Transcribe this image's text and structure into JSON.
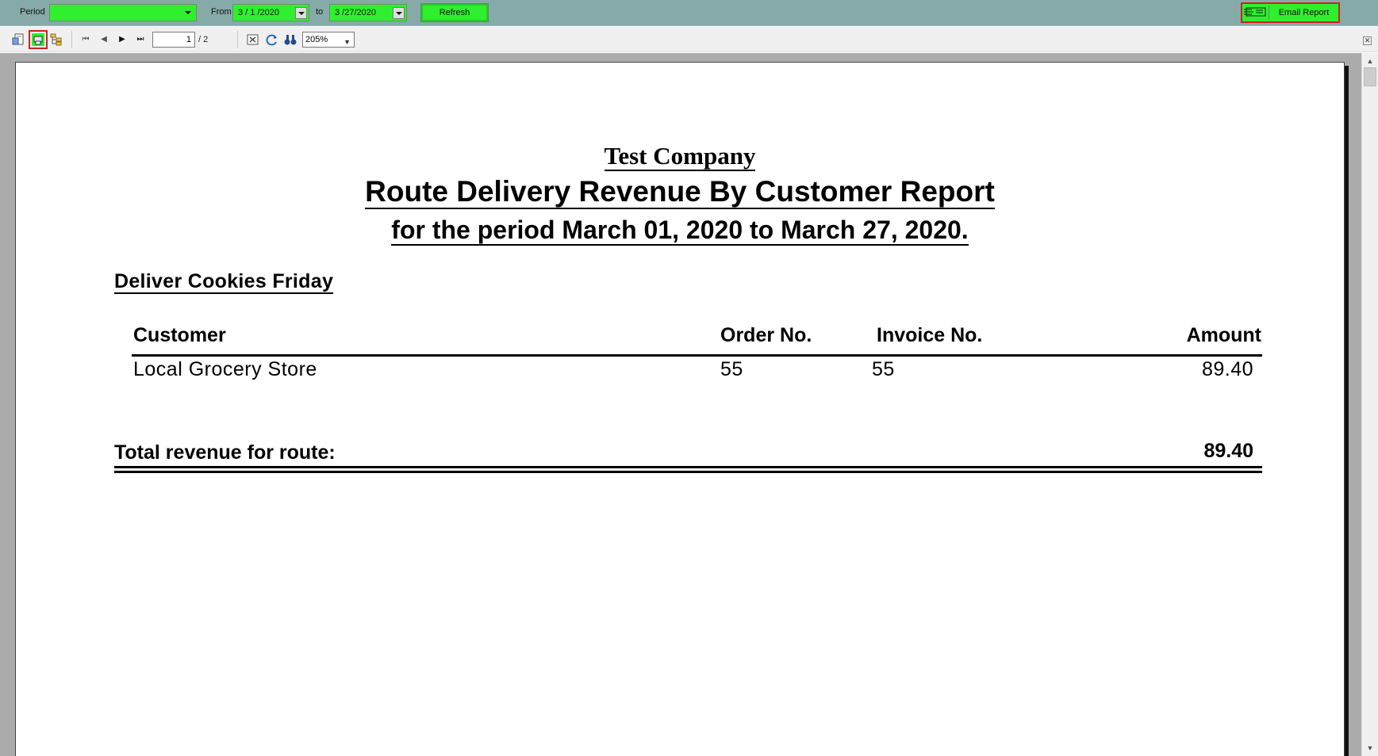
{
  "params": {
    "period_label": "Period",
    "period_value": "",
    "from_label": "From",
    "from_value": "3 / 1 /2020",
    "to_label": "to",
    "to_value": "3 /27/2020",
    "refresh_label": "Refresh",
    "email_label": "Email Report"
  },
  "toolbar": {
    "page_current": "1",
    "page_total": "/ 2",
    "zoom": "205%"
  },
  "report": {
    "company": "Test Company",
    "title": "Route Delivery Revenue By Customer Report",
    "period_line": "for the period March 01, 2020 to March 27, 2020.",
    "route_name": "Deliver Cookies Friday",
    "columns": {
      "customer": "Customer",
      "order_no": "Order No.",
      "invoice_no": "Invoice No.",
      "amount": "Amount"
    },
    "rows": [
      {
        "customer": "Local Grocery Store",
        "order_no": "55",
        "invoice_no": "55",
        "amount": "89.40"
      }
    ],
    "total_label": "Total revenue for route:",
    "total_value": "89.40"
  },
  "colors": {
    "param_bar": "#86aaa8",
    "control_green": "#2ef02e",
    "highlight_red": "#d02020",
    "viewer_bg": "#ababab"
  }
}
